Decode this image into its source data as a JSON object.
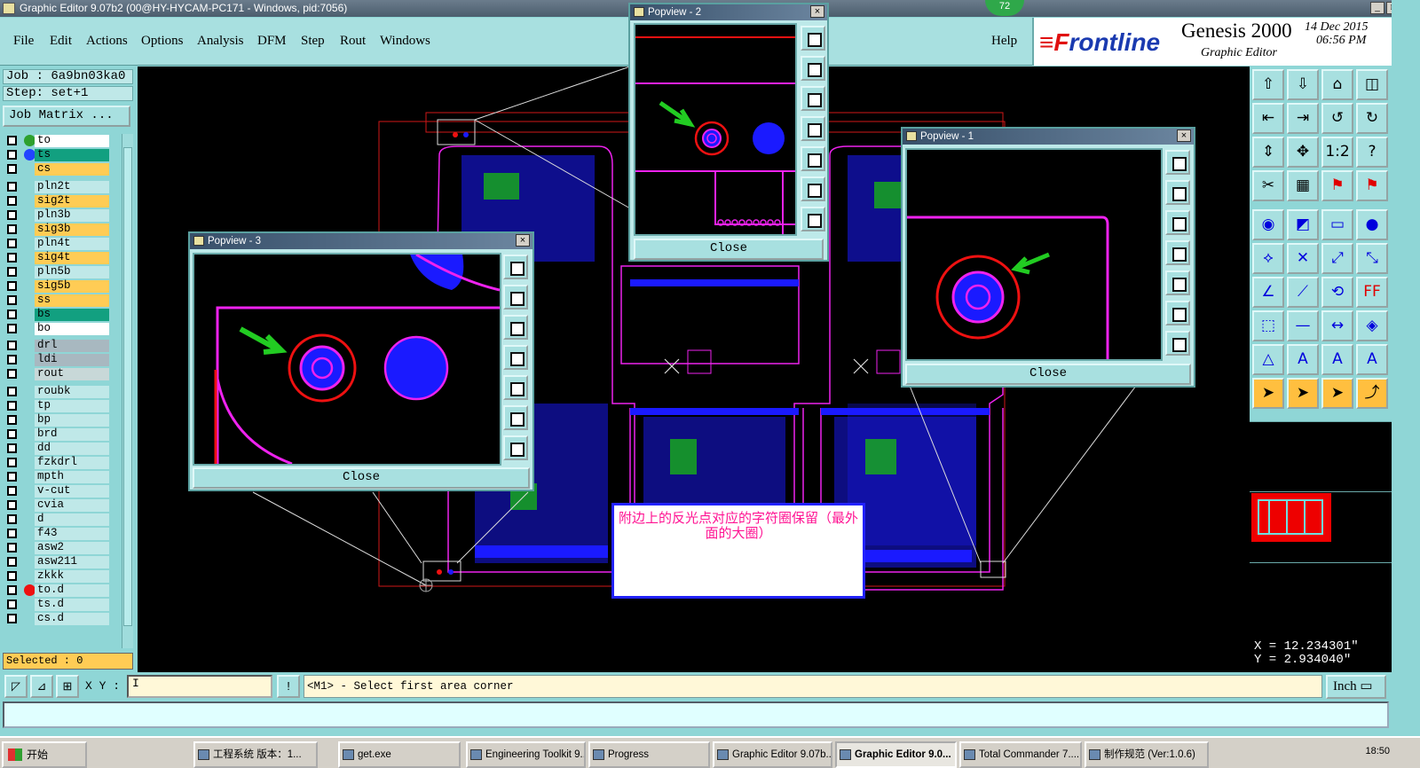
{
  "titlebar": {
    "title": "Graphic Editor 9.07b2 (00@HY-HYCAM-PC171 - Windows, pid:7056)",
    "minimize": "_",
    "maximize": "□",
    "close": "×"
  },
  "badge": "72",
  "menu": {
    "file": "File",
    "edit": "Edit",
    "actions": "Actions",
    "options": "Options",
    "analysis": "Analysis",
    "dfm": "DFM",
    "step": "Step",
    "rout": "Rout",
    "windows": "Windows",
    "help": "Help"
  },
  "brand": {
    "logo_prefix": "≡F",
    "logo_rest": "rontline",
    "product": "Genesis 2000",
    "subtitle": "Graphic Editor",
    "date": "14 Dec 2015",
    "time": "06:56 PM"
  },
  "job": {
    "job_line": "Job : 6a9bn03ka0",
    "step_line": "Step: set+1",
    "job_matrix": "Job Matrix ..."
  },
  "layers": [
    {
      "name": "to",
      "color": "#ffffff",
      "dot": "#2ea02e"
    },
    {
      "name": "ts",
      "color": "#12a080",
      "dot": "#2244ff"
    },
    {
      "name": "cs",
      "color": "#ffcc55",
      "dot": ""
    },
    {
      "name": "pln2t",
      "color": "#bfe8e8",
      "dot": ""
    },
    {
      "name": "sig2t",
      "color": "#ffcc55",
      "dot": ""
    },
    {
      "name": "pln3b",
      "color": "#bfe8e8",
      "dot": ""
    },
    {
      "name": "sig3b",
      "color": "#ffcc55",
      "dot": ""
    },
    {
      "name": "pln4t",
      "color": "#bfe8e8",
      "dot": ""
    },
    {
      "name": "sig4t",
      "color": "#ffcc55",
      "dot": ""
    },
    {
      "name": "pln5b",
      "color": "#bfe8e8",
      "dot": ""
    },
    {
      "name": "sig5b",
      "color": "#ffcc55",
      "dot": ""
    },
    {
      "name": "ss",
      "color": "#ffcc55",
      "dot": ""
    },
    {
      "name": "bs",
      "color": "#12a080",
      "dot": ""
    },
    {
      "name": "bo",
      "color": "#ffffff",
      "dot": ""
    },
    {
      "name": "drl",
      "color": "#a8b8c0",
      "dot": ""
    },
    {
      "name": "ldi",
      "color": "#a8b8c0",
      "dot": ""
    },
    {
      "name": "rout",
      "color": "#c8d8d8",
      "dot": ""
    },
    {
      "name": "roubk",
      "color": "#bfe8e8",
      "dot": ""
    },
    {
      "name": "tp",
      "color": "#bfe8e8",
      "dot": ""
    },
    {
      "name": "bp",
      "color": "#bfe8e8",
      "dot": ""
    },
    {
      "name": "brd",
      "color": "#bfe8e8",
      "dot": ""
    },
    {
      "name": "dd",
      "color": "#bfe8e8",
      "dot": ""
    },
    {
      "name": "fzkdrl",
      "color": "#bfe8e8",
      "dot": ""
    },
    {
      "name": "mpth",
      "color": "#bfe8e8",
      "dot": ""
    },
    {
      "name": "v-cut",
      "color": "#bfe8e8",
      "dot": ""
    },
    {
      "name": "cvia",
      "color": "#bfe8e8",
      "dot": ""
    },
    {
      "name": "d",
      "color": "#bfe8e8",
      "dot": ""
    },
    {
      "name": "f43",
      "color": "#bfe8e8",
      "dot": ""
    },
    {
      "name": "asw2",
      "color": "#bfe8e8",
      "dot": ""
    },
    {
      "name": "asw211",
      "color": "#bfe8e8",
      "dot": ""
    },
    {
      "name": "zkkk",
      "color": "#bfe8e8",
      "dot": ""
    },
    {
      "name": "to.d",
      "color": "#bfe8e8",
      "dot": "#ee1111"
    },
    {
      "name": "ts.d",
      "color": "#bfe8e8",
      "dot": ""
    },
    {
      "name": "cs.d",
      "color": "#bfe8e8",
      "dot": ""
    }
  ],
  "selected": "Selected : 0",
  "popviews": {
    "p1": {
      "title": "Popview - 1",
      "close_label": "Close"
    },
    "p2": {
      "title": "Popview - 2",
      "close_label": "Close"
    },
    "p3": {
      "title": "Popview - 3",
      "close_label": "Close"
    }
  },
  "note": "附边上的反光点对应的字符圈保留（最外面的大圈）",
  "coords": {
    "x": "X = 12.234301\"",
    "y": "Y = 2.934040\""
  },
  "cmd": {
    "xy_label": "X Y :",
    "xy_value": "I",
    "excl": "!",
    "prompt": "<M1> - Select first area corner",
    "unit": "Inch ▭"
  },
  "taskbar": {
    "start": "开始",
    "tasks": [
      "工程系统  版本：1...",
      "get.exe",
      "Engineering Toolkit 9....",
      "Progress",
      "Graphic Editor 9.07b...",
      "Graphic Editor 9.0...",
      "Total Commander 7....",
      "制作规范 (Ver:1.0.6)"
    ],
    "clock": "18:50"
  },
  "colors": {
    "canvas": "#000000",
    "accent": "#8fd6d6",
    "highlight": "#ffcc55",
    "circle_red": "#ee1111",
    "pad_blue": "#1a1aff",
    "outline_magenta": "#ee22ee"
  }
}
